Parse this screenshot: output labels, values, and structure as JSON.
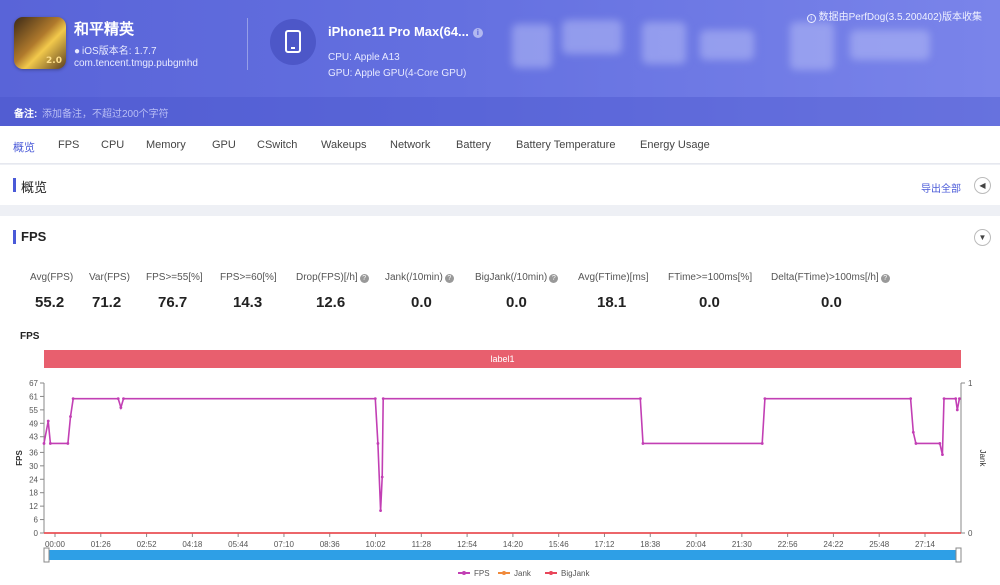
{
  "app": {
    "name": "和平精英",
    "version": "iOS版本名: 1.7.7",
    "package": "com.tencent.tmgp.pubgmhd",
    "icon_text": "2.0"
  },
  "device": {
    "name": "iPhone11 Pro Max(64...",
    "cpu": "CPU: Apple A13",
    "gpu": "GPU: Apple GPU(4-Core GPU)"
  },
  "collect_note": "数据由PerfDog(3.5.200402)版本收集",
  "note": {
    "label": "备注:",
    "placeholder": "添加备注，不超过200个字符"
  },
  "tabs": [
    "概览",
    "FPS",
    "CPU",
    "Memory",
    "GPU",
    "CSwitch",
    "Wakeups",
    "Network",
    "Battery",
    "Battery Temperature",
    "Energy Usage"
  ],
  "active_tab": "概览",
  "overview": {
    "title": "概览",
    "export_label": "导出全部"
  },
  "fps_section": {
    "title": "FPS",
    "stats": [
      {
        "label": "Avg(FPS)",
        "value": "55.2",
        "help": false
      },
      {
        "label": "Var(FPS)",
        "value": "71.2",
        "help": false
      },
      {
        "label": "FPS>=55[%]",
        "value": "76.7",
        "help": false
      },
      {
        "label": "FPS>=60[%]",
        "value": "14.3",
        "help": false
      },
      {
        "label": "Drop(FPS)[/h]",
        "value": "12.6",
        "help": true
      },
      {
        "label": "Jank(/10min)",
        "value": "0.0",
        "help": true
      },
      {
        "label": "BigJank(/10min)",
        "value": "0.0",
        "help": true
      },
      {
        "label": "Avg(FTime)[ms]",
        "value": "18.1",
        "help": false
      },
      {
        "label": "FTime>=100ms[%]",
        "value": "0.0",
        "help": false
      },
      {
        "label": "Delta(FTime)>100ms[/h]",
        "value": "0.0",
        "help": true
      }
    ]
  },
  "colors": {
    "accent": "#4a5ad8",
    "fps_line": "#c23fb4",
    "jank_line": "#f08a3c",
    "bigjank_line": "#e8465a",
    "label_bar": "#e85f6e",
    "scrollbar": "#2e9fe6"
  },
  "chart_data": {
    "type": "line",
    "title": "FPS",
    "label_band": "label1",
    "ylabel": "FPS",
    "y2label": "Jank",
    "ylim": [
      0,
      67
    ],
    "y2lim": [
      0,
      1
    ],
    "yticks": [
      0,
      6,
      12,
      18,
      24,
      30,
      36,
      43,
      49,
      55,
      61,
      67
    ],
    "y2ticks": [
      0,
      1
    ],
    "xticks": [
      "00:00",
      "01:26",
      "02:52",
      "04:18",
      "05:44",
      "07:10",
      "08:36",
      "10:02",
      "11:28",
      "12:54",
      "14:20",
      "15:46",
      "17:12",
      "18:38",
      "20:04",
      "21:30",
      "22:56",
      "24:22",
      "25:48",
      "27:14"
    ],
    "x_unit": "seconds",
    "xlim": [
      0,
      1730
    ],
    "legend": [
      "FPS",
      "Jank",
      "BigJank"
    ],
    "legend_position": "bottom",
    "series": [
      {
        "name": "FPS",
        "points": [
          [
            0,
            40
          ],
          [
            8,
            50
          ],
          [
            12,
            40
          ],
          [
            45,
            40
          ],
          [
            50,
            52
          ],
          [
            55,
            60
          ],
          [
            140,
            60
          ],
          [
            145,
            56
          ],
          [
            150,
            60
          ],
          [
            625,
            60
          ],
          [
            630,
            40
          ],
          [
            635,
            10
          ],
          [
            638,
            25
          ],
          [
            640,
            60
          ],
          [
            1125,
            60
          ],
          [
            1130,
            40
          ],
          [
            1355,
            40
          ],
          [
            1360,
            60
          ],
          [
            1635,
            60
          ],
          [
            1640,
            45
          ],
          [
            1645,
            40
          ],
          [
            1690,
            40
          ],
          [
            1695,
            35
          ],
          [
            1698,
            60
          ],
          [
            1720,
            60
          ],
          [
            1723,
            55
          ],
          [
            1727,
            60
          ]
        ]
      },
      {
        "name": "Jank",
        "points": [
          [
            0,
            0
          ],
          [
            1730,
            0
          ]
        ]
      },
      {
        "name": "BigJank",
        "points": [
          [
            0,
            0
          ],
          [
            1730,
            0
          ]
        ]
      }
    ]
  }
}
